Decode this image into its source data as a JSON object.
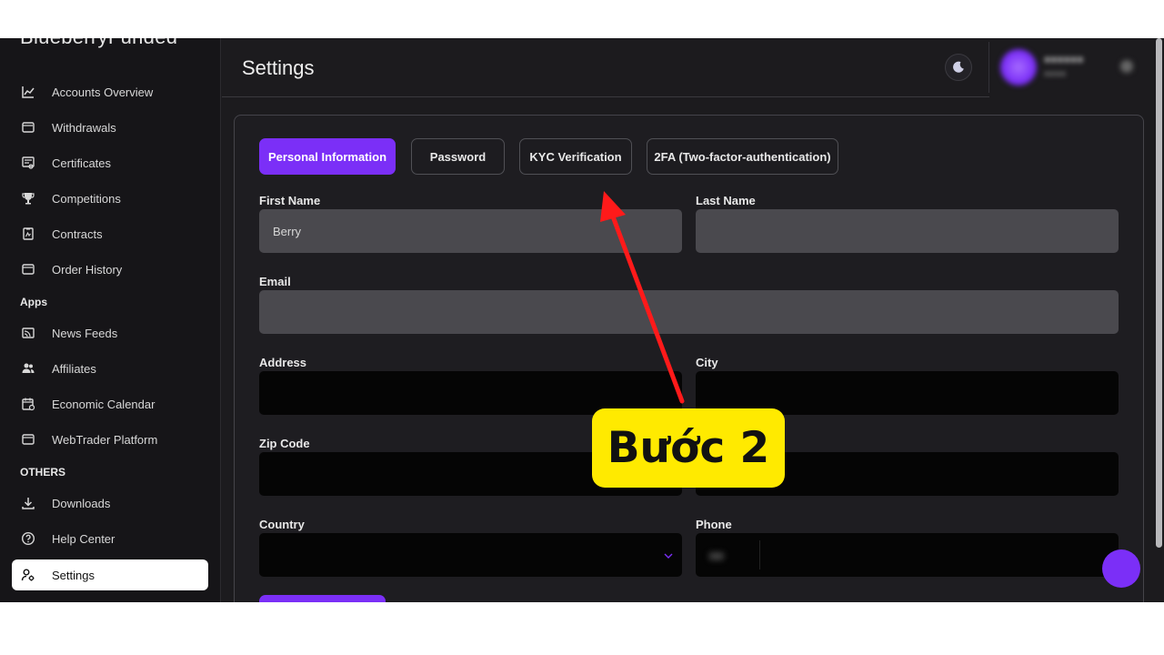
{
  "app": {
    "brand": "BlueberryFunded"
  },
  "sidebar": {
    "items": [
      {
        "label": "Accounts Overview",
        "icon": "chart-line-icon"
      },
      {
        "label": "Withdrawals",
        "icon": "wallet-icon"
      },
      {
        "label": "Certificates",
        "icon": "certificate-icon"
      },
      {
        "label": "Competitions",
        "icon": "trophy-icon"
      },
      {
        "label": "Contracts",
        "icon": "contract-icon"
      },
      {
        "label": "Order History",
        "icon": "wallet-icon"
      }
    ],
    "apps_title": "Apps",
    "apps": [
      {
        "label": "News Feeds",
        "icon": "cast-icon"
      },
      {
        "label": "Affiliates",
        "icon": "people-icon"
      },
      {
        "label": "Economic Calendar",
        "icon": "calendar-icon"
      },
      {
        "label": "WebTrader Platform",
        "icon": "wallet-icon"
      }
    ],
    "others_title": "OTHERS",
    "others": [
      {
        "label": "Downloads",
        "icon": "download-icon"
      },
      {
        "label": "Help Center",
        "icon": "help-icon"
      },
      {
        "label": "Settings",
        "icon": "user-settings-icon",
        "active": true
      }
    ]
  },
  "header": {
    "title": "Settings"
  },
  "tabs": [
    {
      "label": "Personal Information",
      "active": true
    },
    {
      "label": "Password"
    },
    {
      "label": "KYC Verification"
    },
    {
      "label": "2FA (Two-factor-authentication)"
    }
  ],
  "form": {
    "first_name": {
      "label": "First Name",
      "value": "Berry"
    },
    "last_name": {
      "label": "Last Name",
      "value": ""
    },
    "email": {
      "label": "Email",
      "value": ""
    },
    "address": {
      "label": "Address",
      "value": ""
    },
    "city": {
      "label": "City",
      "value": ""
    },
    "zip": {
      "label": "Zip Code",
      "value": ""
    },
    "country": {
      "label": "Country",
      "value": ""
    },
    "phone": {
      "label": "Phone",
      "value": ""
    }
  },
  "annotation": {
    "text": "Bước 2"
  },
  "colors": {
    "accent": "#7b2ff7",
    "callout": "#ffea00",
    "arrow": "#ff1a1a"
  }
}
